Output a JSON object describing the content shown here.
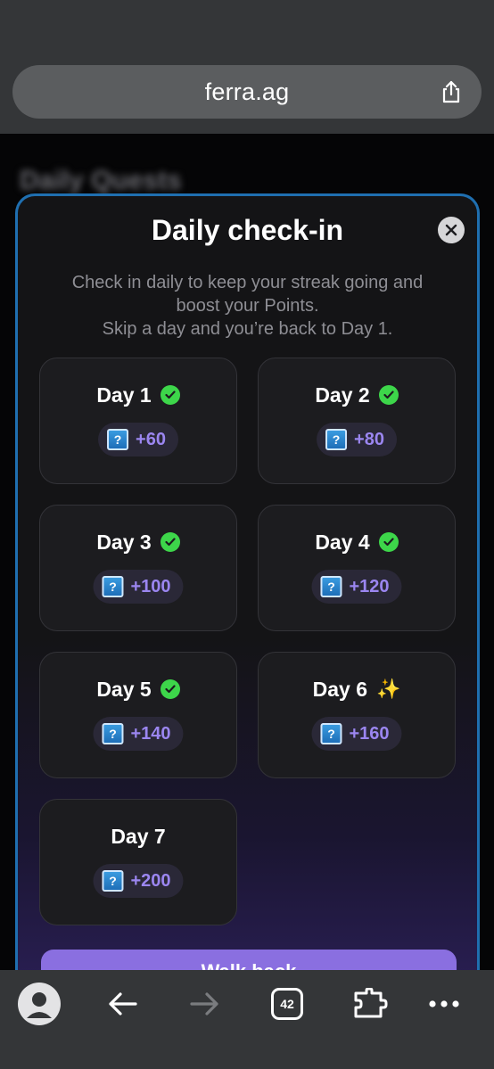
{
  "browser": {
    "url": "ferra.ag",
    "tab_count": "42"
  },
  "page": {
    "background_title": "Daily Quests"
  },
  "modal": {
    "title": "Daily check-in",
    "subtitle_line1": "Check in daily to keep your streak going and",
    "subtitle_line2": "boost your Points.",
    "subtitle_line3": "Skip a day and you’re back to Day 1.",
    "cta_label": "Walk back",
    "days": [
      {
        "label": "Day 1",
        "reward": "+60",
        "status": "checked"
      },
      {
        "label": "Day 2",
        "reward": "+80",
        "status": "checked"
      },
      {
        "label": "Day 3",
        "reward": "+100",
        "status": "checked"
      },
      {
        "label": "Day 4",
        "reward": "+120",
        "status": "checked"
      },
      {
        "label": "Day 5",
        "reward": "+140",
        "status": "checked"
      },
      {
        "label": "Day 6",
        "reward": "+160",
        "status": "current"
      },
      {
        "label": "Day 7",
        "reward": "+200",
        "status": "upcoming"
      }
    ]
  },
  "colors": {
    "accent_purple": "#8a6fe0",
    "check_green": "#3dd64a",
    "modal_border": "#1f6fb0"
  },
  "icons": {
    "share": "share-icon",
    "close": "close-icon",
    "check": "check-icon",
    "sparkle": "sparkle-icon",
    "mystery_box": "mystery-box-icon",
    "back": "back-arrow-icon",
    "forward": "forward-arrow-icon",
    "tabs": "tabs-icon",
    "extensions": "extensions-icon",
    "more": "more-icon"
  }
}
